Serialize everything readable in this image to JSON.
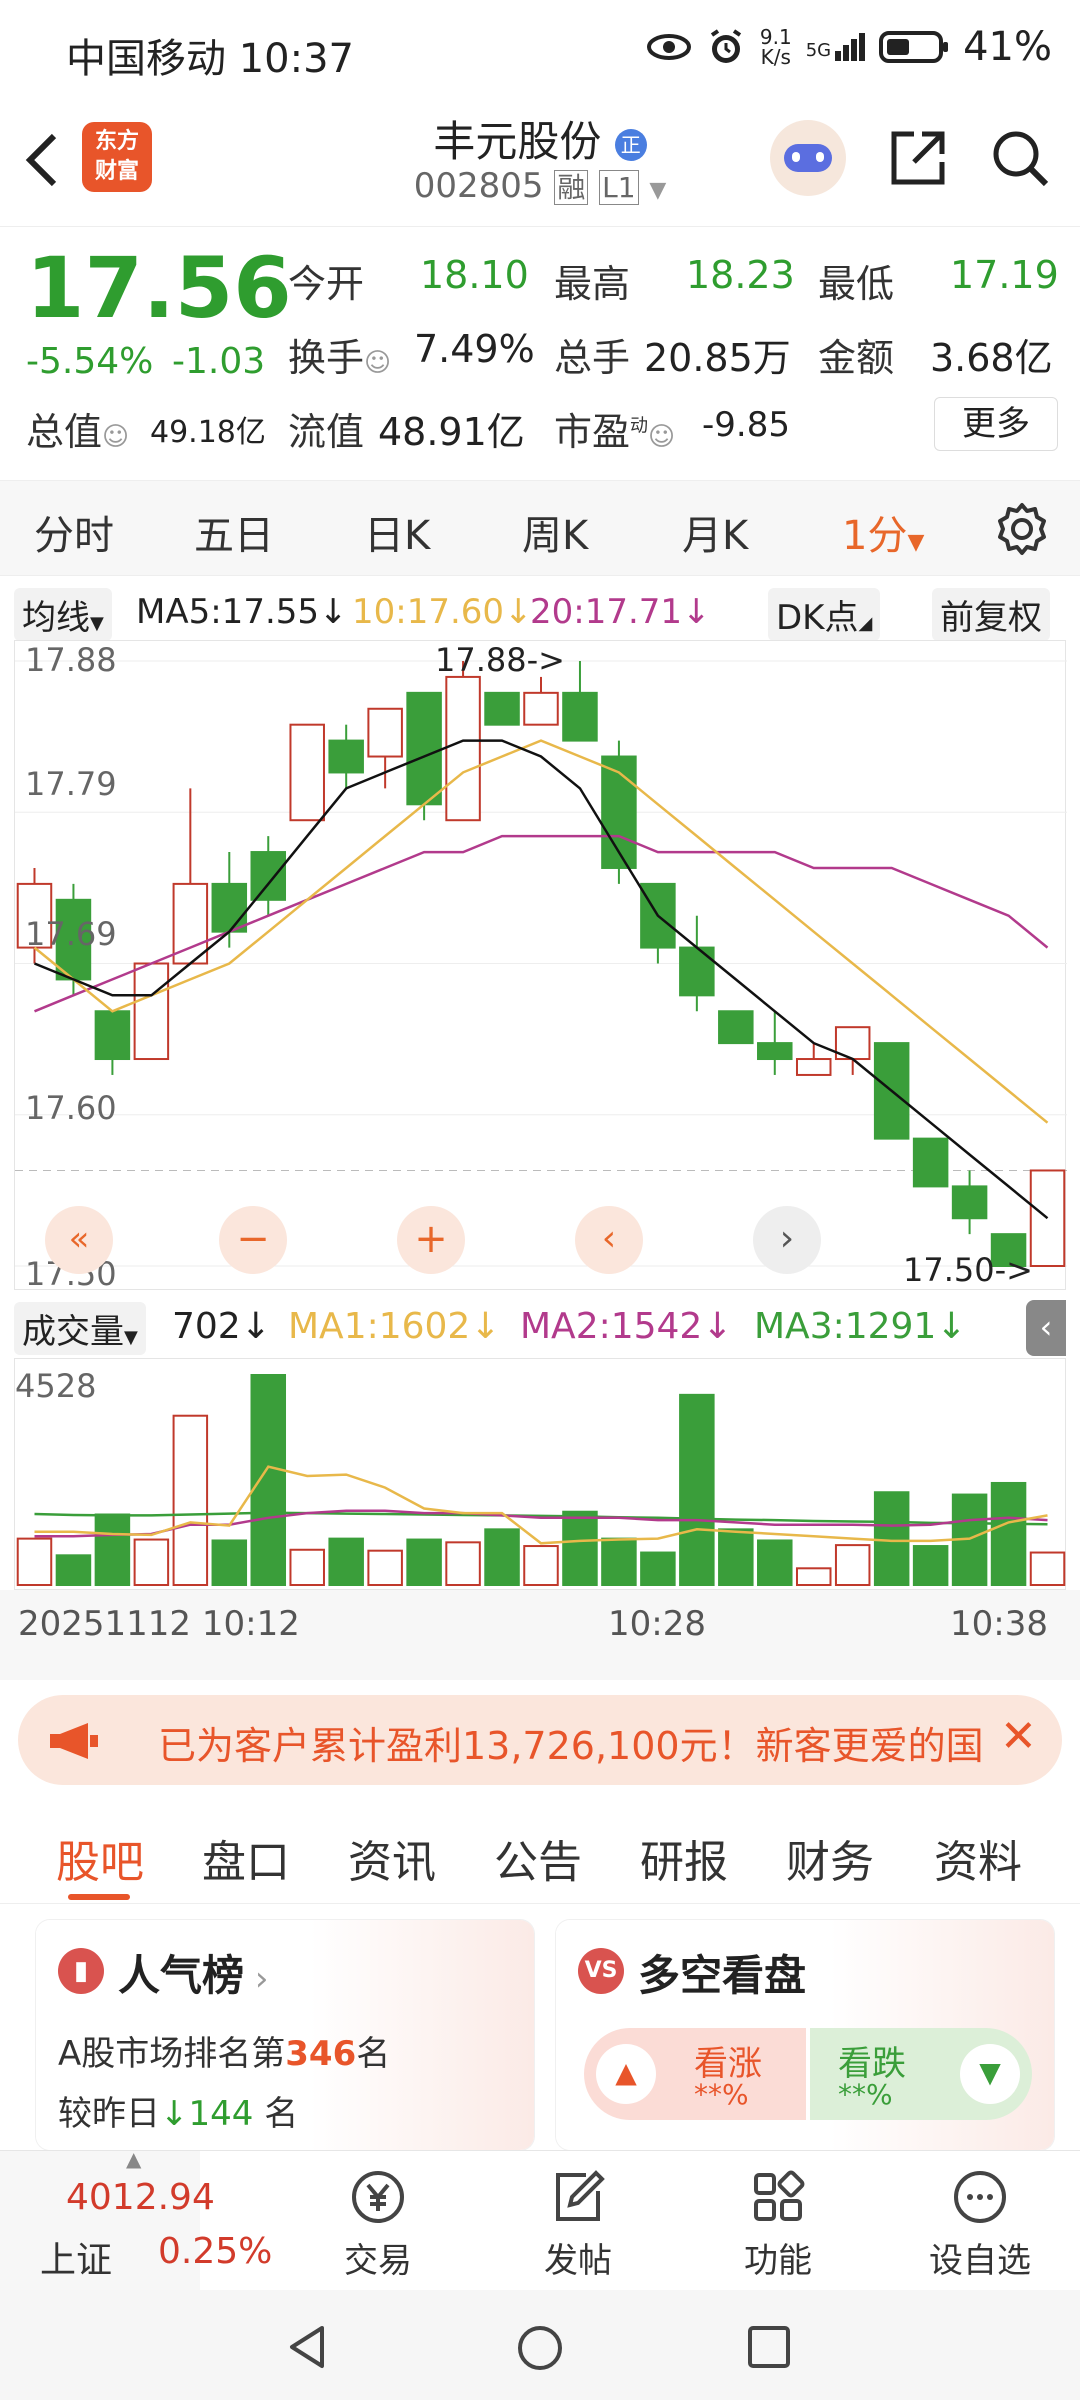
{
  "status": {
    "carrier_time": "中国移动 10:37",
    "net_speed_top": "9.1",
    "net_speed_bottom": "K/s",
    "net_type": "5G",
    "battery": "41%"
  },
  "header": {
    "app_logo_line1": "东方",
    "app_logo_line2": "财富",
    "stock_name": "丰元股份",
    "stock_badge": "正",
    "stock_code": "002805",
    "margin_tag": "融",
    "level_tag": "L1"
  },
  "quote": {
    "price": "17.56",
    "change_pct": "-5.54%",
    "change_abs": "-1.03",
    "open_label": "今开",
    "open": "18.10",
    "high_label": "最高",
    "high": "18.23",
    "low_label": "最低",
    "low": "17.19",
    "turnover_label": "换手",
    "turnover": "7.49%",
    "volume_label": "总手",
    "volume": "20.85万",
    "amount_label": "金额",
    "amount": "3.68亿",
    "mktcap_label": "总值",
    "mktcap": "49.18亿",
    "float_label": "流值",
    "float": "48.91亿",
    "pe_label": "市盈",
    "pe_sup": "动",
    "pe": "-9.85",
    "more_label": "更多"
  },
  "period_tabs": [
    "分时",
    "五日",
    "日K",
    "周K",
    "月K",
    "1分"
  ],
  "ma_legend": {
    "label": "均线",
    "ma5": "MA5:17.55",
    "ma10": "10:17.60",
    "ma20": "20:17.71",
    "dk": "DK点",
    "adjust": "前复权"
  },
  "price_axis": [
    "17.88",
    "17.79",
    "17.69",
    "17.60",
    "17.50"
  ],
  "price_marks": {
    "high": "17.88",
    "low": "17.50"
  },
  "volume_legend": {
    "label": "成交量",
    "vol": "702",
    "ma1": "MA1:1602",
    "ma2": "MA2:1542",
    "ma3": "MA3:1291"
  },
  "volume_axis_top": "4528",
  "time_axis": {
    "start": "20251112 10:12",
    "mid": "10:28",
    "end": "10:38"
  },
  "colors": {
    "up": "#c0392b",
    "down": "#3a9e3a",
    "ma5": "#111111",
    "ma10": "#e8b84a",
    "ma20": "#b23a8c",
    "accent": "#e8672a"
  },
  "chart_data": {
    "type": "candlestick",
    "ylim": [
      17.5,
      17.88
    ],
    "candles": [
      {
        "o": 17.7,
        "c": 17.74,
        "h": 17.75,
        "l": 17.69
      },
      {
        "o": 17.73,
        "c": 17.68,
        "h": 17.74,
        "l": 17.67
      },
      {
        "o": 17.66,
        "c": 17.63,
        "h": 17.66,
        "l": 17.62
      },
      {
        "o": 17.63,
        "c": 17.69,
        "h": 17.69,
        "l": 17.63
      },
      {
        "o": 17.69,
        "c": 17.74,
        "h": 17.8,
        "l": 17.69
      },
      {
        "o": 17.74,
        "c": 17.71,
        "h": 17.76,
        "l": 17.7
      },
      {
        "o": 17.76,
        "c": 17.73,
        "h": 17.77,
        "l": 17.72
      },
      {
        "o": 17.78,
        "c": 17.84,
        "h": 17.84,
        "l": 17.78
      },
      {
        "o": 17.83,
        "c": 17.81,
        "h": 17.84,
        "l": 17.8
      },
      {
        "o": 17.82,
        "c": 17.85,
        "h": 17.85,
        "l": 17.8
      },
      {
        "o": 17.86,
        "c": 17.79,
        "h": 17.86,
        "l": 17.78
      },
      {
        "o": 17.78,
        "c": 17.87,
        "h": 17.88,
        "l": 17.78
      },
      {
        "o": 17.86,
        "c": 17.84,
        "h": 17.86,
        "l": 17.84
      },
      {
        "o": 17.84,
        "c": 17.86,
        "h": 17.87,
        "l": 17.84
      },
      {
        "o": 17.86,
        "c": 17.83,
        "h": 17.88,
        "l": 17.83
      },
      {
        "o": 17.82,
        "c": 17.75,
        "h": 17.83,
        "l": 17.74
      },
      {
        "o": 17.74,
        "c": 17.7,
        "h": 17.74,
        "l": 17.69
      },
      {
        "o": 17.7,
        "c": 17.67,
        "h": 17.72,
        "l": 17.66
      },
      {
        "o": 17.66,
        "c": 17.64,
        "h": 17.66,
        "l": 17.64
      },
      {
        "o": 17.64,
        "c": 17.63,
        "h": 17.66,
        "l": 17.62
      },
      {
        "o": 17.62,
        "c": 17.63,
        "h": 17.64,
        "l": 17.62
      },
      {
        "o": 17.63,
        "c": 17.65,
        "h": 17.65,
        "l": 17.62
      },
      {
        "o": 17.64,
        "c": 17.58,
        "h": 17.64,
        "l": 17.58
      },
      {
        "o": 17.58,
        "c": 17.55,
        "h": 17.58,
        "l": 17.55
      },
      {
        "o": 17.55,
        "c": 17.53,
        "h": 17.56,
        "l": 17.52
      },
      {
        "o": 17.52,
        "c": 17.5,
        "h": 17.52,
        "l": 17.5
      },
      {
        "o": 17.5,
        "c": 17.56,
        "h": 17.56,
        "l": 17.5
      }
    ],
    "ma5": [
      17.69,
      17.68,
      17.67,
      17.67,
      17.69,
      17.71,
      17.74,
      17.77,
      17.8,
      17.81,
      17.82,
      17.83,
      17.83,
      17.82,
      17.8,
      17.76,
      17.72,
      17.7,
      17.68,
      17.66,
      17.64,
      17.63,
      17.61,
      17.59,
      17.57,
      17.55,
      17.53
    ],
    "ma10": [
      17.7,
      17.68,
      17.66,
      17.67,
      17.68,
      17.69,
      17.71,
      17.73,
      17.75,
      17.77,
      17.79,
      17.81,
      17.82,
      17.83,
      17.82,
      17.81,
      17.79,
      17.77,
      17.75,
      17.73,
      17.71,
      17.69,
      17.67,
      17.65,
      17.63,
      17.61,
      17.59
    ],
    "ma20": [
      17.66,
      17.67,
      17.68,
      17.69,
      17.7,
      17.71,
      17.72,
      17.73,
      17.74,
      17.75,
      17.76,
      17.76,
      17.77,
      17.77,
      17.77,
      17.77,
      17.76,
      17.76,
      17.76,
      17.76,
      17.75,
      17.75,
      17.75,
      17.74,
      17.73,
      17.72,
      17.7
    ],
    "volumes": [
      1000,
      640,
      1520,
      980,
      3650,
      960,
      4528,
      760,
      1000,
      740,
      980,
      920,
      1200,
      840,
      1580,
      1000,
      700,
      4100,
      1200,
      960,
      360,
      860,
      2000,
      840,
      1950,
      2200,
      700
    ],
    "vol_ma1": [
      1150,
      1150,
      1100,
      1080,
      1350,
      1280,
      2550,
      2350,
      2380,
      2100,
      1650,
      1550,
      1550,
      900,
      950,
      980,
      1000,
      1200,
      1150,
      1100,
      1050,
      1000,
      950,
      950,
      1000,
      1350,
      1500
    ],
    "vol_ma2": [
      1050,
      1050,
      1080,
      1100,
      1300,
      1300,
      1450,
      1550,
      1600,
      1600,
      1550,
      1550,
      1500,
      1450,
      1450,
      1450,
      1400,
      1400,
      1350,
      1300,
      1300,
      1300,
      1280,
      1300,
      1400,
      1450,
      1400
    ],
    "vol_ma3": [
      1530,
      1510,
      1500,
      1500,
      1520,
      1540,
      1560,
      1550,
      1540,
      1530,
      1520,
      1510,
      1500,
      1490,
      1480,
      1460,
      1450,
      1430,
      1410,
      1400,
      1380,
      1370,
      1360,
      1340,
      1330,
      1320,
      1310
    ]
  },
  "banner": {
    "text": "已为客户累计盈利13,726,100元！新客更爱的国"
  },
  "section_tabs": [
    "股吧",
    "盘口",
    "资讯",
    "公告",
    "研报",
    "财务",
    "资料"
  ],
  "popularity": {
    "title": "人气榜",
    "rank_prefix": "A股市场排名第",
    "rank": "346",
    "rank_suffix": "名",
    "change_prefix": "较昨日",
    "change": "144",
    "change_suffix": "名"
  },
  "longshort": {
    "title": "多空看盘",
    "up_label": "看涨",
    "up_value": "**%",
    "down_label": "看跌",
    "down_value": "**%"
  },
  "index_quote": {
    "value": "4012.94",
    "name": "上证",
    "pct": "0.25%"
  },
  "bottom_nav": [
    "交易",
    "发帖",
    "功能",
    "设自选"
  ]
}
